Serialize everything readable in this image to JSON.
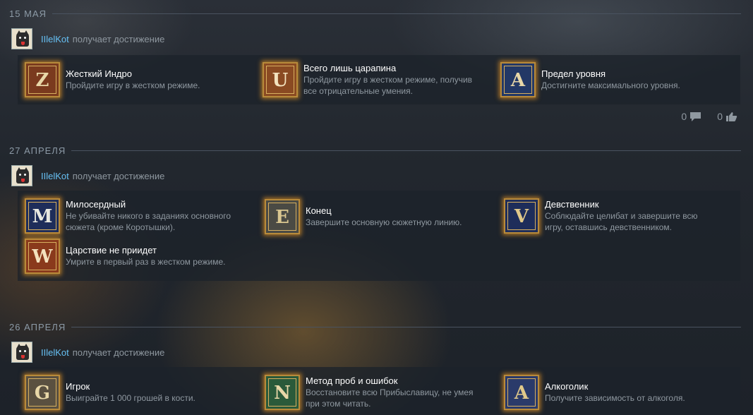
{
  "feed": [
    {
      "date": "15 МАЯ",
      "user": "IIlelKot",
      "action": "получает достижение",
      "achievements": [
        {
          "title": "Жесткий Индро",
          "desc_lines": [
            "Пройдите игру в жестком режиме."
          ],
          "icon": "knight-icon",
          "glyph": "Z",
          "bg": "#7a3a1e",
          "fg": "#e8d7a8"
        },
        {
          "title": "Всего лишь царапина",
          "desc_lines": [
            "Пройдите игру в жестком режиме, получив",
            "все отрицательные умения."
          ],
          "icon": "scratch-icon",
          "glyph": "U",
          "bg": "#8a4a22",
          "fg": "#f3e2be"
        },
        {
          "title": "Предел уровня",
          "desc_lines": [
            "Достигните максимального уровня."
          ],
          "icon": "crowned-figure-icon",
          "glyph": "A",
          "bg": "#233866",
          "fg": "#e8d7a8"
        }
      ],
      "social": {
        "comments": "0",
        "likes": "0"
      }
    },
    {
      "date": "27 АПРЕЛЯ",
      "user": "IIlelKot",
      "action": "получает достижение",
      "achievements": [
        {
          "title": "Милосердный",
          "desc_lines": [
            "Не убивайте никого в заданиях основного",
            "сюжета (кроме Коротышки)."
          ],
          "icon": "angel-icon",
          "glyph": "M",
          "bg": "#1e2d5a",
          "fg": "#e8e8e0"
        },
        {
          "title": "Конец",
          "desc_lines": [
            "Завершите основную сюжетную линию."
          ],
          "icon": "end-icon",
          "glyph": "E",
          "bg": "#4a4a44",
          "fg": "#d9c690"
        },
        {
          "title": "Девственник",
          "desc_lines": [
            "Соблюдайте целибат и завершите всю",
            "игру, оставшись девственником."
          ],
          "icon": "virgin-icon",
          "glyph": "V",
          "bg": "#1e2d5a",
          "fg": "#e0c88a"
        },
        {
          "title": "Царствие не приидет",
          "desc_lines": [
            "Умрите в первый раз в жестком режиме."
          ],
          "icon": "skeleton-icon",
          "glyph": "W",
          "bg": "#8a3a1c",
          "fg": "#f3e2be"
        }
      ]
    },
    {
      "date": "26 АПРЕЛЯ",
      "user": "IIlelKot",
      "action": "получает достижение",
      "achievements": [
        {
          "title": "Игрок",
          "desc_lines": [
            "Выиграйте 1 000 грошей в кости."
          ],
          "icon": "dice-icon",
          "glyph": "G",
          "bg": "#5a5040",
          "fg": "#e8d7a8"
        },
        {
          "title": "Метод проб и ошибок",
          "desc_lines": [
            "Восстановите всю Прибыславицу, не умея",
            "при этом читать."
          ],
          "icon": "builder-icon",
          "glyph": "N",
          "bg": "#2a5a3a",
          "fg": "#e8d7a8"
        },
        {
          "title": "Алкоголик",
          "desc_lines": [
            "Получите зависимость от алкоголя."
          ],
          "icon": "drunkard-icon",
          "glyph": "A",
          "bg": "#2a3a6a",
          "fg": "#e0c88a"
        }
      ]
    }
  ]
}
